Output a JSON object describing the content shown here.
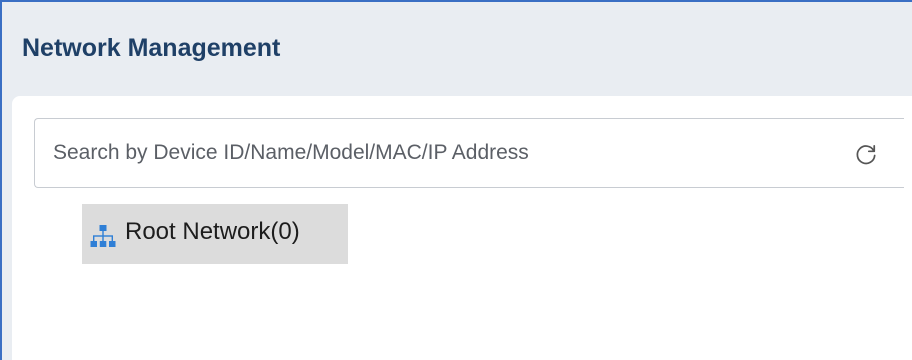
{
  "header": {
    "title": "Network Management"
  },
  "search": {
    "placeholder": "Search by Device ID/Name/Model/MAC/IP Address",
    "value": "",
    "refresh_icon": "refresh-icon"
  },
  "tree": {
    "nodes": [
      {
        "label": "Root Network(0)",
        "icon": "network-topology-icon",
        "selected": true
      }
    ]
  },
  "colors": {
    "accent_border": "#3a6fc4",
    "title_text": "#1f4067",
    "header_bg": "#e9edf2",
    "selected_bg": "#dcdcdc",
    "icon_blue": "#2f7fd6"
  }
}
